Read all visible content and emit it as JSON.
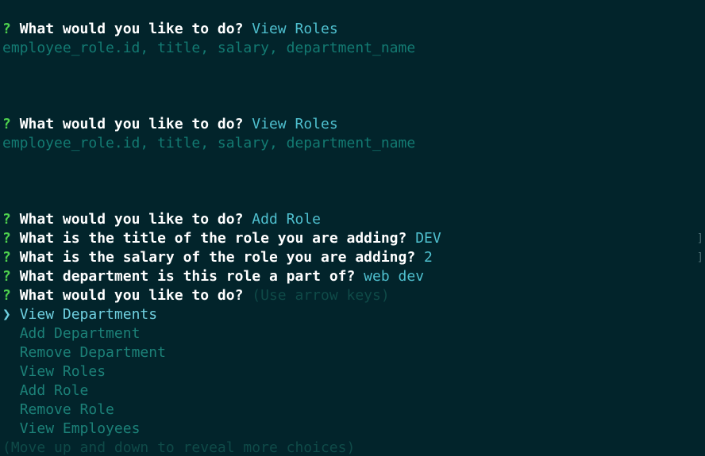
{
  "lines": [
    {
      "q": "?",
      "prompt": "What would you like to do?",
      "answer": "View Roles"
    },
    {
      "text": "employee_role.id, title, salary, department_name"
    },
    {
      "q": "?",
      "prompt": "What would you like to do?",
      "answer": "View Roles"
    },
    {
      "text": "employee_role.id, title, salary, department_name"
    },
    {
      "q": "?",
      "prompt": "What would you like to do?",
      "answer": "Add Role"
    },
    {
      "q": "?",
      "prompt": "What is the title of the role you are adding?",
      "answer": "DEV"
    },
    {
      "q": "?",
      "prompt": "What is the salary of the role you are adding?",
      "answer": "2"
    },
    {
      "q": "?",
      "prompt": "What department is this role a part of?",
      "answer": "web dev"
    },
    {
      "q": "?",
      "prompt": "What would you like to do?",
      "hint": "(Use arrow keys)"
    }
  ],
  "menu": {
    "pointer": "❯",
    "selected": "View Departments",
    "choices": [
      "Add Department",
      "Remove Department",
      "View Roles",
      "Add Role",
      "Remove Role",
      "View Employees"
    ],
    "footer": "(Move up and down to reveal more choices)"
  },
  "edge_marks": [
    "]",
    "]"
  ],
  "colors": {
    "background": "#02242b",
    "question_mark": "#4ed24e",
    "answer": "#4fc0cf",
    "output": "#137a72",
    "selected": "#6fd0e0"
  }
}
